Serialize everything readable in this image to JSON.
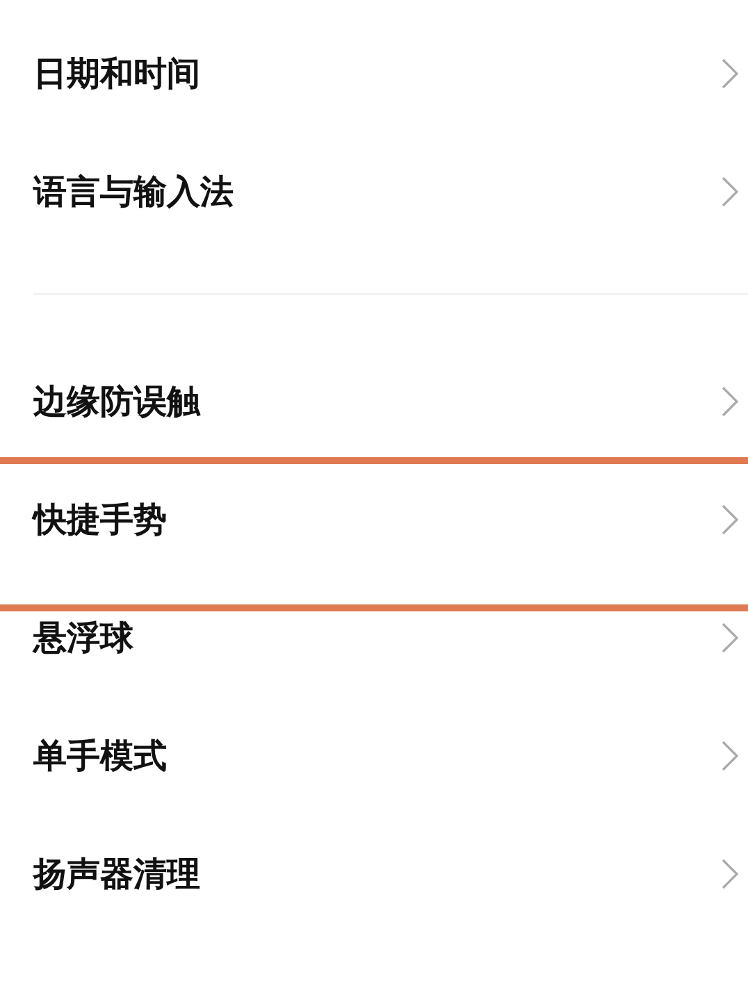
{
  "groups": [
    {
      "items": [
        {
          "label": "日期和时间",
          "highlighted": false
        },
        {
          "label": "语言与输入法",
          "highlighted": false
        }
      ]
    },
    {
      "items": [
        {
          "label": "边缘防误触",
          "highlighted": false
        },
        {
          "label": "快捷手势",
          "highlighted": true
        },
        {
          "label": "悬浮球",
          "highlighted": false
        },
        {
          "label": "单手模式",
          "highlighted": false
        },
        {
          "label": "扬声器清理",
          "highlighted": false
        }
      ]
    }
  ]
}
